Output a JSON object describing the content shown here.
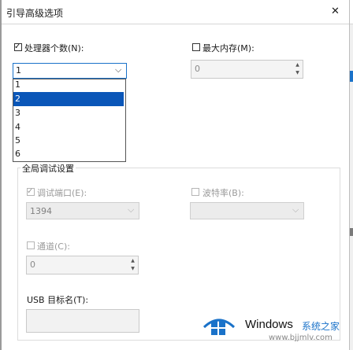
{
  "window": {
    "title": "引导高级选项",
    "close_glyph": "✕"
  },
  "processors": {
    "label": "处理器个数(N):",
    "checked": true,
    "selected": "1",
    "options": [
      "1",
      "2",
      "3",
      "4",
      "5",
      "6"
    ],
    "highlighted_option": "2"
  },
  "memory": {
    "label": "最大内存(M):",
    "checked": false,
    "value": "0"
  },
  "debug": {
    "group_label": "全局调试设置",
    "debug_port_label": "调试端口(E):",
    "debug_port_checked": true,
    "debug_port_value": "1394",
    "baud_label": "波特率(B):",
    "channel_label": "通道(C):",
    "channel_value": "0",
    "usb_label": "USB 目标名(T):"
  },
  "watermark": {
    "brand": "Windows",
    "suffix": "系统之家",
    "url": "www.bjjmlv.com"
  },
  "colors": {
    "selection": "#0a56b8",
    "accent_blue": "#1a72c9"
  }
}
